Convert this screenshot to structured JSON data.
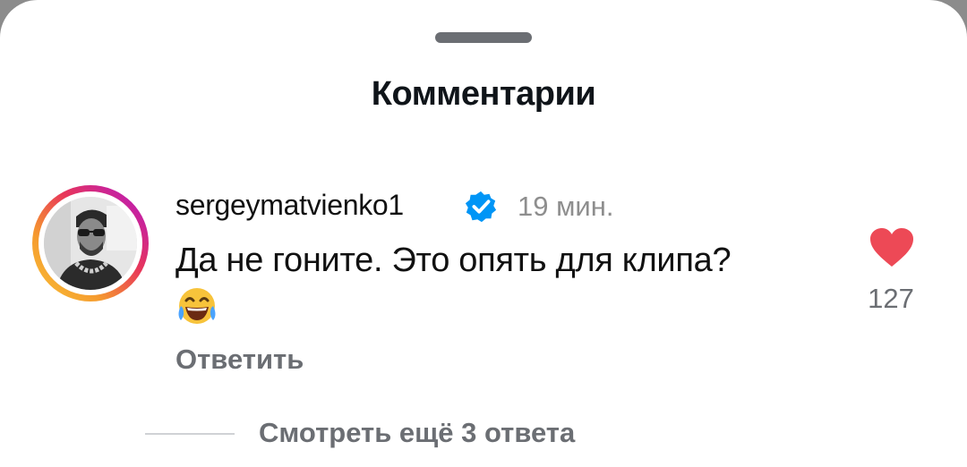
{
  "sheet": {
    "title": "Комментарии"
  },
  "comment": {
    "username": "sergeymatvienko1",
    "verified_icon": "verified-badge-icon",
    "time": "19 мин.",
    "text": "Да не гоните. Это опять для клипа?",
    "emoji": "😂",
    "like_count": "127",
    "reply_label": "Ответить",
    "view_replies_label": "Смотреть ещё 3 ответа"
  },
  "colors": {
    "accent_like": "#ed4956",
    "verified_blue": "#0095f6",
    "muted_text": "#6b6e73",
    "story_ring": [
      "#f9c437",
      "#e8365a",
      "#a51fb8"
    ]
  }
}
